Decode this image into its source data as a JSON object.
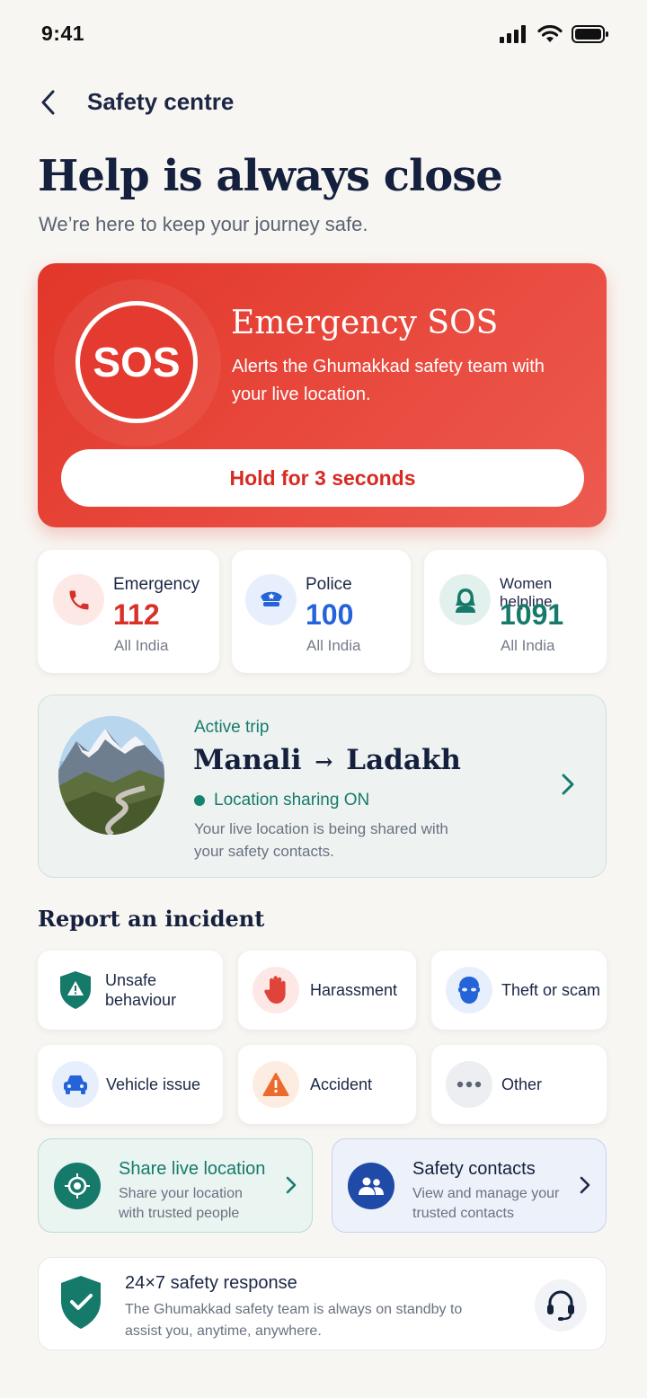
{
  "status_bar": {
    "time": "9:41"
  },
  "header": {
    "title": "Safety centre"
  },
  "hero": {
    "title": "Help is always close",
    "subtitle": "We’re here to keep your journey safe."
  },
  "sos": {
    "badge": "SOS",
    "title": "Emergency SOS",
    "description": "Alerts the Ghumakkad safety team with your live location.",
    "button_label": "Hold for 3 seconds"
  },
  "helplines": [
    {
      "name": "Emergency",
      "number": "112",
      "area": "All India",
      "color": "#d8302b",
      "icon": "phone-icon"
    },
    {
      "name": "Police",
      "number": "100",
      "area": "All India",
      "color": "#2463d8",
      "icon": "police-cap-icon"
    },
    {
      "name": "Women helpline",
      "number": "1091",
      "area": "All India",
      "color": "#167a6b",
      "icon": "woman-icon"
    }
  ],
  "trip": {
    "label": "Active trip",
    "from": "Manali",
    "arrow": "→",
    "to": "Ladakh",
    "status": "Location sharing ON",
    "description": "Your live location is being shared with your safety contacts."
  },
  "report": {
    "title": "Report an incident",
    "items": [
      {
        "label": "Unsafe behaviour",
        "icon": "warning-shield-icon"
      },
      {
        "label": "Harassment",
        "icon": "stop-hand-icon"
      },
      {
        "label": "Theft or scam",
        "icon": "masked-thief-icon"
      },
      {
        "label": "Vehicle issue",
        "icon": "car-icon"
      },
      {
        "label": "Accident",
        "icon": "warning-triangle-icon"
      },
      {
        "label": "Other",
        "icon": "more-dots-icon"
      }
    ]
  },
  "share": {
    "title": "Share live location",
    "description": "Share your location with trusted people"
  },
  "contacts": {
    "title": "Safety contacts",
    "description": "View and manage your trusted contacts"
  },
  "response": {
    "title": "24×7 safety response",
    "description": "The Ghumakkad safety team is always on standby to assist you, anytime, anywhere."
  },
  "colors": {
    "sos_red": "#e53a2f",
    "teal": "#167a6b",
    "navy": "#14203d",
    "blue": "#1f4aa8"
  }
}
